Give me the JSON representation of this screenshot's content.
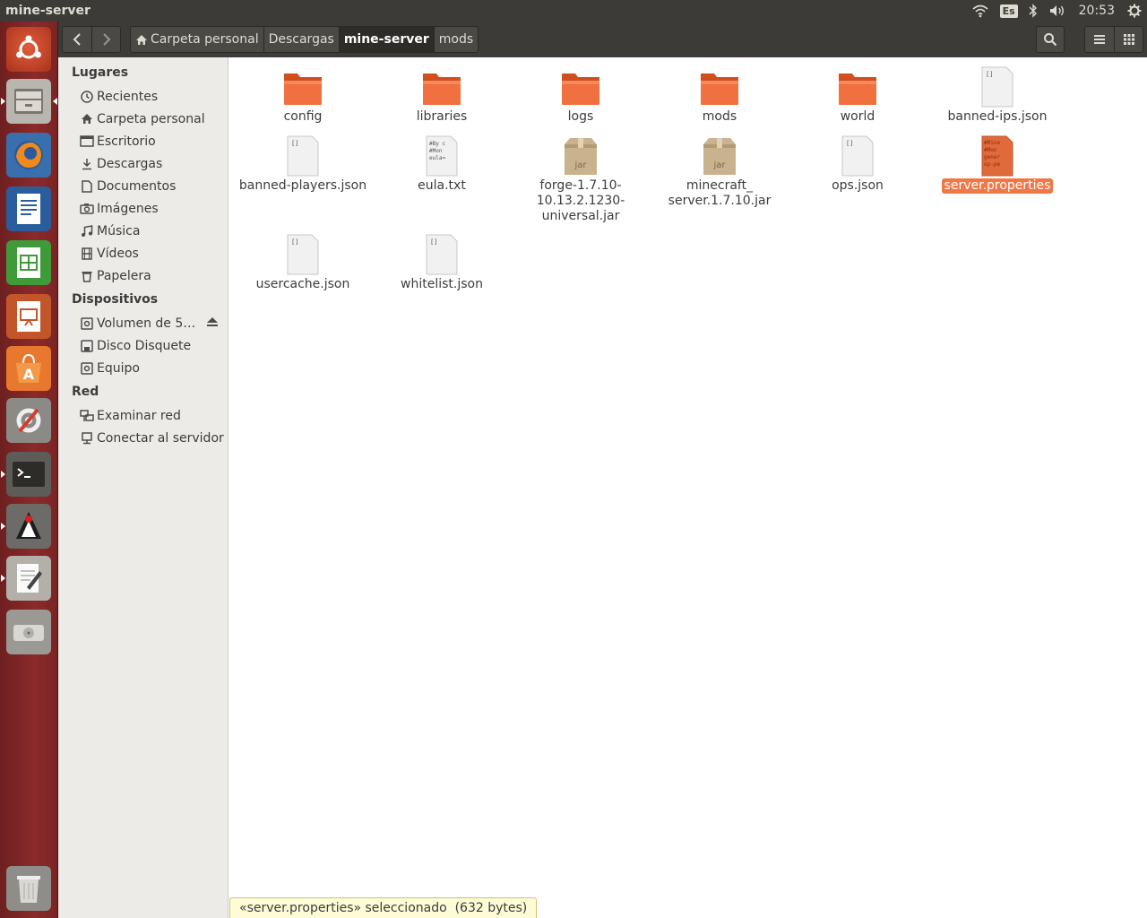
{
  "window_title": "mine-server",
  "tray": {
    "keyboard": "Es",
    "clock": "20:53"
  },
  "launcher": [
    "ubuntu-dash",
    "files",
    "firefox",
    "writer",
    "calc",
    "impress",
    "software-center",
    "system-settings",
    "terminal",
    "java",
    "text-editor",
    "disk",
    "trash"
  ],
  "breadcrumbs": [
    "Carpeta personal",
    "Descargas",
    "mine-server",
    "mods"
  ],
  "sidebar": {
    "places_title": "Lugares",
    "places": [
      "Recientes",
      "Carpeta personal",
      "Escritorio",
      "Descargas",
      "Documentos",
      "Imágenes",
      "Música",
      "Vídeos",
      "Papelera"
    ],
    "devices_title": "Dispositivos",
    "devices": [
      "Volumen de 5…",
      "Disco Disquete",
      "Equipo"
    ],
    "network_title": "Red",
    "network": [
      "Examinar red",
      "Conectar al servidor"
    ]
  },
  "files": [
    {
      "name": "config",
      "type": "folder"
    },
    {
      "name": "libraries",
      "type": "folder"
    },
    {
      "name": "logs",
      "type": "folder"
    },
    {
      "name": "mods",
      "type": "folder"
    },
    {
      "name": "world",
      "type": "folder"
    },
    {
      "name": "banned-ips.json",
      "type": "json"
    },
    {
      "name": "banned-players.json",
      "type": "json"
    },
    {
      "name": "eula.txt",
      "type": "text"
    },
    {
      "name": "forge-1.7.10-\n10.13.2.1230-\nuniversal.jar",
      "type": "jar"
    },
    {
      "name": "minecraft_\nserver.1.7.10.jar",
      "type": "jar"
    },
    {
      "name": "ops.json",
      "type": "json"
    },
    {
      "name": "server.properties",
      "type": "props",
      "selected": true
    },
    {
      "name": "usercache.json",
      "type": "json"
    },
    {
      "name": "whitelist.json",
      "type": "json"
    }
  ],
  "status": "«server.properties» seleccionado  (632 bytes)",
  "colors": {
    "panel": "#3c3b37",
    "launcher": "#8b2a2a",
    "accent": "#f07746",
    "sidebar": "#edebe8"
  }
}
